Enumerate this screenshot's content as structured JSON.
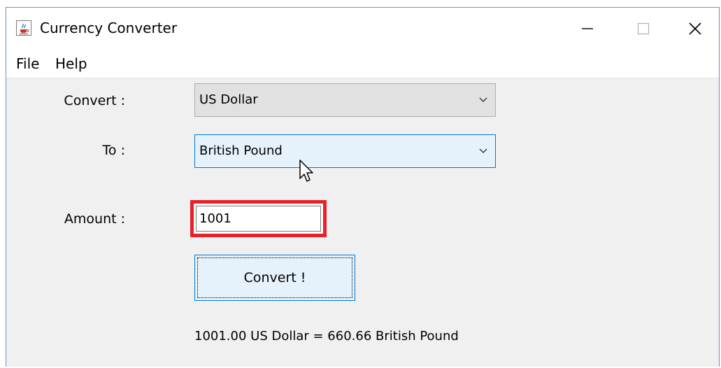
{
  "window": {
    "title": "Currency Converter",
    "icon": "java-cup-icon"
  },
  "menu": {
    "items": [
      "File",
      "Help"
    ]
  },
  "form": {
    "convert_label": "Convert :",
    "from_currency": "US Dollar",
    "to_label": "To :",
    "to_currency": "British Pound",
    "amount_label": "Amount :",
    "amount_value": "1001",
    "convert_button": "Convert !",
    "result": "1001.00 US Dollar = 660.66 British Pound"
  },
  "colors": {
    "highlight": "#e8202a",
    "focus_border": "#0078d7",
    "button_hover_bg": "#e5f1fb",
    "window_bg": "#f0f0f0"
  }
}
